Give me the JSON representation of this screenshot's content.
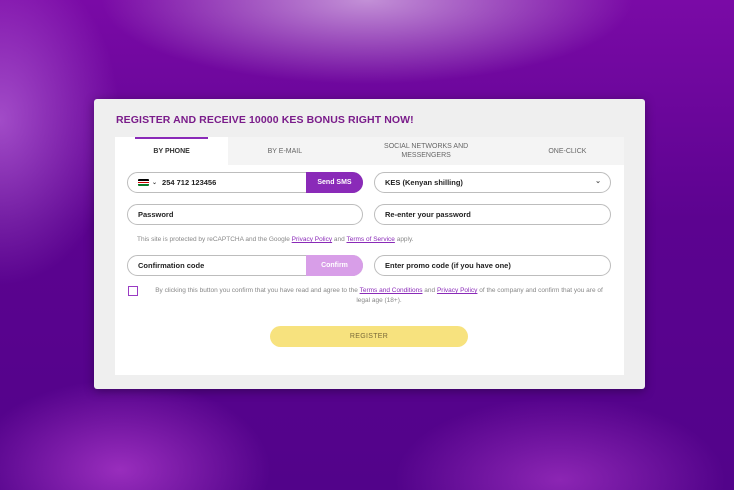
{
  "modal": {
    "title": "REGISTER AND RECEIVE 10000 KES BONUS RIGHT NOW!"
  },
  "tabs": [
    {
      "label": "BY PHONE",
      "active": true
    },
    {
      "label": "BY E-MAIL",
      "active": false
    },
    {
      "label": "SOCIAL NETWORKS AND MESSENGERS",
      "active": false
    },
    {
      "label": "ONE-CLICK",
      "active": false
    }
  ],
  "phone": {
    "value": "254 712 123456",
    "country_icon": "kenya-flag-icon",
    "send_sms_label": "Send SMS"
  },
  "currency": {
    "selected": "KES (Kenyan shilling)"
  },
  "password": {
    "placeholder": "Password"
  },
  "confirm_password": {
    "placeholder": "Re-enter your password"
  },
  "recaptcha": {
    "text_1": "This site is protected by reCAPTCHA and the Google",
    "privacy_link": "Privacy Policy",
    "and": "and",
    "terms_link": "Terms of Service",
    "text_2": "apply."
  },
  "confirmation_code": {
    "placeholder": "Confirmation code",
    "confirm_label": "Confirm"
  },
  "promo_code": {
    "placeholder": "Enter promo code (if you have one)"
  },
  "consent": {
    "text_1": "By clicking this button you confirm that you have read and agree to the",
    "terms_link": "Terms and Conditions",
    "and": "and",
    "privacy_link": "Privacy Policy",
    "text_2": "of the company and confirm that you are of legal age (18+)."
  },
  "register_label": "REGISTER",
  "colors": {
    "accent": "#8a2ab8",
    "register_button": "#f7e27e",
    "title": "#7a1c8a"
  }
}
